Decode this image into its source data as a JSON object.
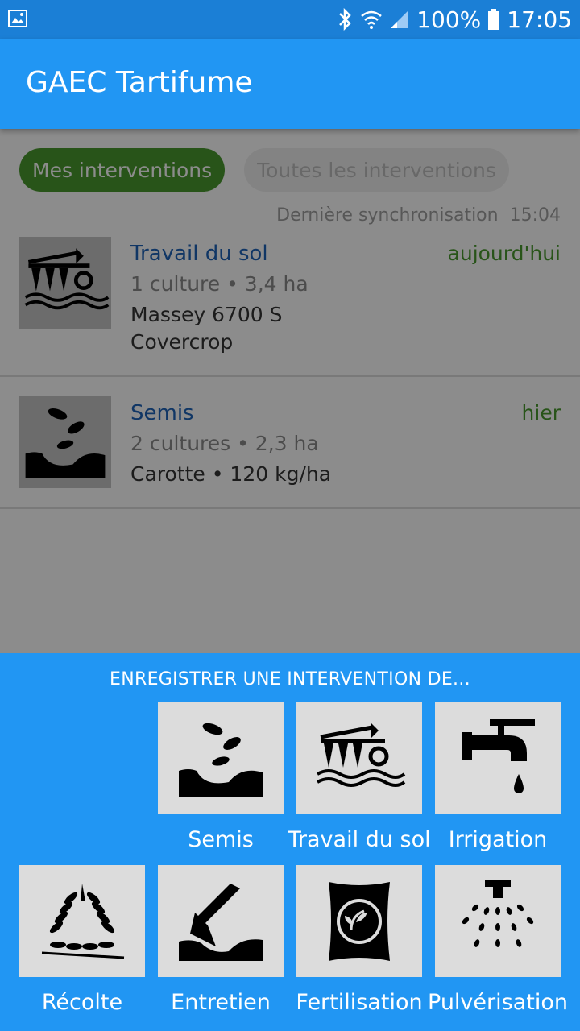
{
  "status_bar": {
    "battery": "100%",
    "time": "17:05",
    "icons": [
      "image-icon",
      "bluetooth-icon",
      "wifi-icon",
      "signal-icon",
      "battery-icon"
    ]
  },
  "app_bar": {
    "title": "GAEC Tartifume"
  },
  "tabs": [
    {
      "label": "Mes interventions",
      "active": true
    },
    {
      "label": "Toutes les interventions",
      "active": false
    }
  ],
  "sync": {
    "label": "Dernière synchronisation",
    "time": "15:04"
  },
  "interventions": [
    {
      "icon": "plough-icon",
      "name": "Travail du sol",
      "date": "aujourd'hui",
      "meta": "1 culture • 3,4 ha",
      "detail_1": "Massey 6700 S",
      "detail_2": "Covercrop"
    },
    {
      "icon": "sowing-icon",
      "name": "Semis",
      "date": "hier",
      "meta": "2 cultures • 2,3 ha",
      "detail_1": "Carotte • 120 kg/ha"
    }
  ],
  "sheet": {
    "heading": "ENREGISTRER UNE INTERVENTION DE...",
    "actions": [
      {
        "label": "Semis",
        "icon": "sowing-icon"
      },
      {
        "label": "Travail du sol",
        "icon": "plough-icon"
      },
      {
        "label": "Irrigation",
        "icon": "faucet-icon"
      },
      {
        "label": "Récolte",
        "icon": "wheat-icon"
      },
      {
        "label": "Entretien",
        "icon": "hoe-icon"
      },
      {
        "label": "Fertilisation",
        "icon": "fertilizer-bag-icon"
      },
      {
        "label": "Pulvérisation",
        "icon": "sprayer-icon"
      }
    ]
  },
  "colors": {
    "primary": "#2196f3",
    "status_bar": "#1b7fd6",
    "accent_green": "#4a9a2f",
    "link_blue": "#1e63b8"
  }
}
